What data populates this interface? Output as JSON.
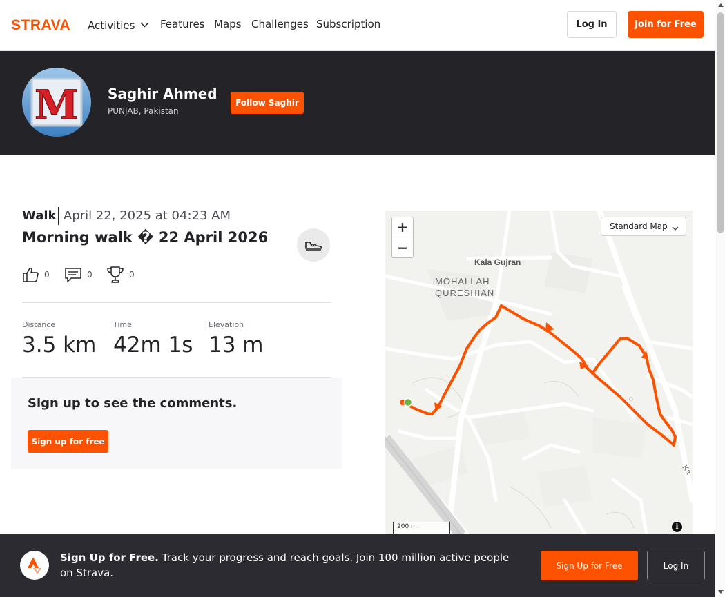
{
  "header": {
    "logo_text": "STRAVA",
    "nav": {
      "activities": "Activities",
      "features": "Features",
      "maps": "Maps",
      "challenges": "Challenges",
      "subscription": "Subscription"
    },
    "login_label": "Log In",
    "join_label": "Join for Free"
  },
  "athlete": {
    "avatar_letter": "M",
    "name": "Saghir Ahmed",
    "location": "PUNJAB, Pakistan",
    "follow_label": "Follow Saghir"
  },
  "activity": {
    "type": "Walk",
    "date": "April 22, 2025 at 04:23 AM",
    "title": "Morning walk � 22 April 2026",
    "kudos_count": "0",
    "comments_count": "0",
    "achievements_count": "0",
    "gear_icon": "shoe-icon",
    "stats": {
      "distance_label": "Distance",
      "distance_value": "3.5 km",
      "time_label": "Time",
      "time_value": "42m 1s",
      "elevation_label": "Elevation",
      "elevation_value": "13 m"
    }
  },
  "comments": {
    "title": "Sign up to see the comments.",
    "button": "Sign up for free"
  },
  "map": {
    "zoom_in": "+",
    "zoom_out": "−",
    "style_select": "Standard Map",
    "scale_label": "200 m",
    "info_label": "i",
    "place_kala_gujran": "Kala Gujran",
    "place_mohallah_1": "MOHALLAH",
    "place_mohallah_2": "QURESHIAN",
    "place_road_edge": "Ka",
    "route_color": "#fc5200",
    "start_color": "#6db33f"
  },
  "signup_bar": {
    "bold": "Sign Up for Free.",
    "text": " Track your progress and reach goals. Join 100 million active people on Strava.",
    "signup_label": "Sign Up for Free",
    "login_label": "Log In"
  },
  "colors": {
    "brand": "#fc5200",
    "dark": "#242428"
  }
}
